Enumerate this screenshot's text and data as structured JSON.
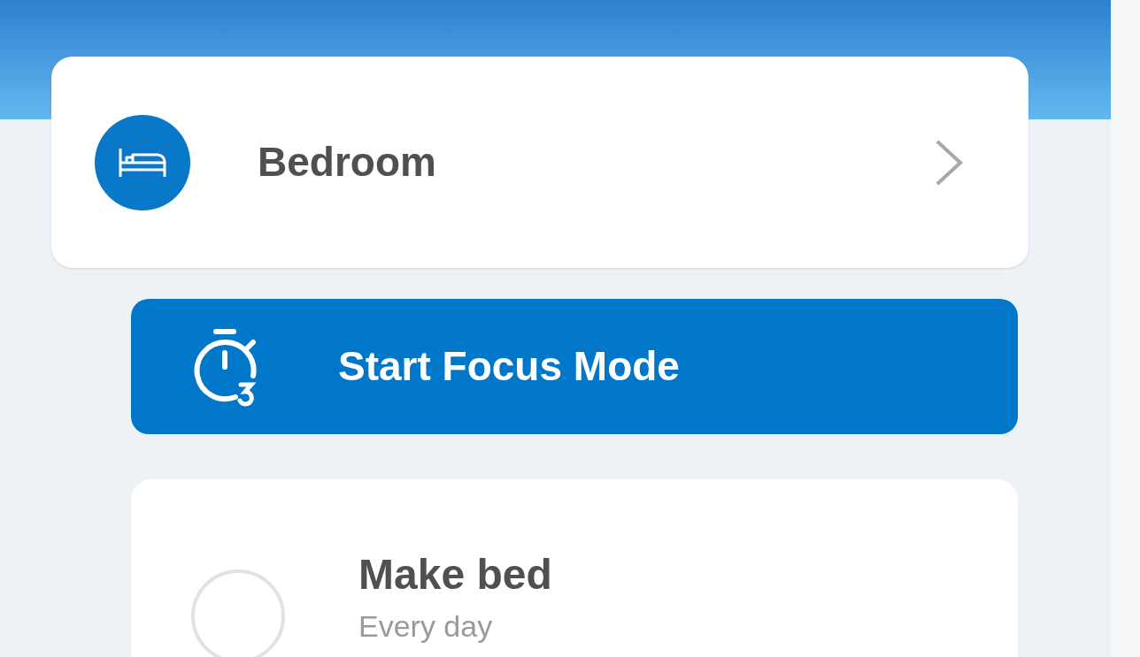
{
  "room": {
    "name": "Bedroom"
  },
  "focus_button": {
    "label": "Start Focus Mode"
  },
  "tasks": [
    {
      "title": "Make bed",
      "schedule": "Every day",
      "checked": false
    }
  ]
}
